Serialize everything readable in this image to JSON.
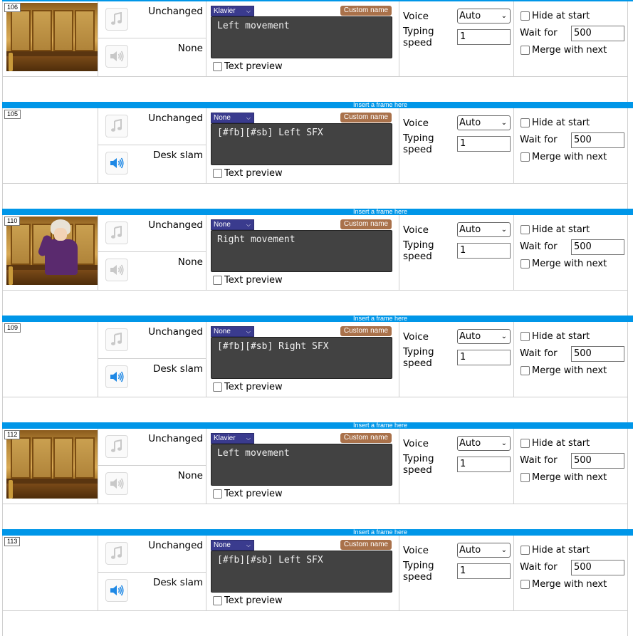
{
  "insert_label": "Insert a frame here",
  "labels": {
    "text_preview": "Text preview",
    "voice": "Voice",
    "typing_speed": "Typing\nspeed",
    "hide_at_start": "Hide at start",
    "wait_for": "Wait for",
    "merge_with_next": "Merge with next",
    "custom_name": "Custom name"
  },
  "frames": [
    {
      "id": "106",
      "scene": "courtroom",
      "music": "Unchanged",
      "sound": "None",
      "sound_active": false,
      "speaker": "Klavier",
      "text": "Left movement",
      "voice": "Auto",
      "typing_speed": "1",
      "wait_for": "500"
    },
    {
      "id": "105",
      "scene": "none",
      "music": "Unchanged",
      "sound": "Desk slam",
      "sound_active": true,
      "speaker": "None",
      "text": "[#fb][#sb] Left SFX",
      "voice": "Auto",
      "typing_speed": "1",
      "wait_for": "500"
    },
    {
      "id": "110",
      "scene": "courtroom-klavier",
      "music": "Unchanged",
      "sound": "None",
      "sound_active": false,
      "speaker": "None",
      "text": "Right movement",
      "voice": "Auto",
      "typing_speed": "1",
      "wait_for": "500"
    },
    {
      "id": "109",
      "scene": "none",
      "music": "Unchanged",
      "sound": "Desk slam",
      "sound_active": true,
      "speaker": "None",
      "text": "[#fb][#sb] Right SFX",
      "voice": "Auto",
      "typing_speed": "1",
      "wait_for": "500"
    },
    {
      "id": "112",
      "scene": "courtroom",
      "music": "Unchanged",
      "sound": "None",
      "sound_active": false,
      "speaker": "Klavier",
      "text": "Left movement",
      "voice": "Auto",
      "typing_speed": "1",
      "wait_for": "500"
    },
    {
      "id": "113",
      "scene": "none",
      "music": "Unchanged",
      "sound": "Desk slam",
      "sound_active": true,
      "speaker": "None",
      "text": "[#fb][#sb] Left SFX",
      "voice": "Auto",
      "typing_speed": "1",
      "wait_for": "500"
    }
  ],
  "icons": {
    "music": "music-note-icon",
    "sound": "speaker-icon",
    "dropdown": "chevron-down-icon"
  },
  "colors": {
    "insert_bar": "#0096e8",
    "dialog_bg": "#424242",
    "name_select": "#3a3b8e",
    "custom_name": "#a9714a",
    "sound_active": "#1e88e5",
    "sound_inactive": "#c8c8c8"
  }
}
